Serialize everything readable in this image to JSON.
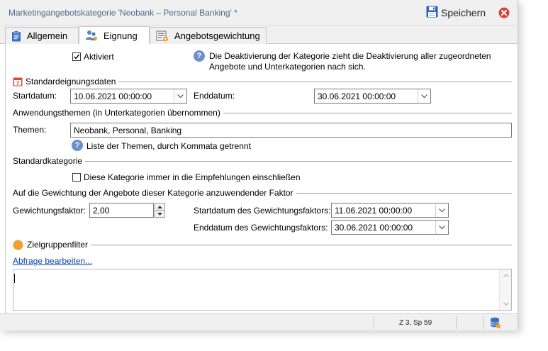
{
  "window": {
    "title": "Marketingangebotskategorie 'Neobank – Personal Banking' *",
    "save_label": "Speichern"
  },
  "tabs": [
    {
      "label": "Allgemein",
      "active": false
    },
    {
      "label": "Eignung",
      "active": true
    },
    {
      "label": "Angebotsgewichtung",
      "active": false
    }
  ],
  "activated": {
    "label": "Aktiviert",
    "checked": true
  },
  "deactivation_help": {
    "line1": "Die Deaktivierung der Kategorie zieht die Deaktivierung aller zugeordneten",
    "line2": "Angebote und Unterkategorien nach sich."
  },
  "default_dates": {
    "section": "Standardeignungsdaten",
    "start_label": "Startdatum:",
    "start_value": "10.06.2021 00:00:00",
    "end_label": "Enddatum:",
    "end_value": "30.06.2021 00:00:00"
  },
  "themes": {
    "section": "Anwendungsthemen (in Unterkategorien übernommen)",
    "label": "Themen:",
    "value": "Neobank, Personal, Banking",
    "help": "Liste der Themen, durch Kommata getrennt"
  },
  "default_category": {
    "section": "Standardkategorie",
    "checkbox_label": "Diese Kategorie immer in die Empfehlungen einschließen",
    "checked": false
  },
  "weighting": {
    "section": "Auf die Gewichtung der Angebote dieser Kategorie anzuwendender Faktor",
    "factor_label": "Gewichtungsfaktor:",
    "factor_value": "2,00",
    "start_label": "Startdatum des Gewichtungsfaktors:",
    "start_value": "11.06.2021 00:00:00",
    "end_label": "Enddatum des Gewichtungsfaktors:",
    "end_value": "30.06.2021 00:00:00"
  },
  "target_filter": {
    "section": "Zielgruppenfilter",
    "edit_link": "Abfrage bearbeiten...",
    "query_text": ""
  },
  "status": {
    "position": "Z 3, Sp 59"
  },
  "colors": {
    "accent_blue": "#6a8fca",
    "close_red": "#d9423a",
    "filter_orange": "#f0a030",
    "link": "#0645ad"
  }
}
